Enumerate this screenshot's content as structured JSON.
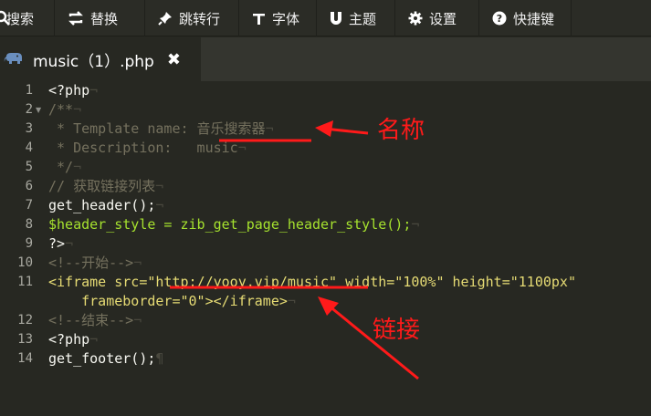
{
  "toolbar": {
    "items": [
      {
        "label": "搜索",
        "icon": "search-icon"
      },
      {
        "label": "替换",
        "icon": "replace-icon"
      },
      {
        "label": "跳转行",
        "icon": "pin-icon"
      },
      {
        "label": "字体",
        "icon": "text-icon"
      },
      {
        "label": "主题",
        "icon": "magnet-icon"
      },
      {
        "label": "设置",
        "icon": "gear-icon"
      },
      {
        "label": "快捷键",
        "icon": "help-icon"
      }
    ]
  },
  "tab": {
    "title": "music（1）.php",
    "icon": "php-elephant-icon",
    "close_icon": "close-icon"
  },
  "editor": {
    "line_numbers": [
      "1",
      "2",
      "3",
      "4",
      "5",
      "6",
      "7",
      "8",
      "9",
      "10",
      "11",
      "12",
      "13",
      "14"
    ],
    "lines": [
      "<?php",
      "/**",
      " * Template name: 音乐搜索器",
      " * Description:   music",
      " */",
      "// 获取链接列表",
      "get_header();",
      "$header_style = zib_get_page_header_style();",
      "?>",
      "<!--开始-->",
      "<iframe src=\"http://yooy.vip/music\" width=\"100%\" height=\"1100px\"",
      "    frameborder=\"0\"></iframe>",
      "<!--结束-->",
      "<?php",
      "get_footer();"
    ]
  },
  "annotations": {
    "name_label": "名称",
    "link_label": "链接"
  },
  "colors": {
    "annotation": "#ff1a1a",
    "editor_bg": "#272822"
  }
}
